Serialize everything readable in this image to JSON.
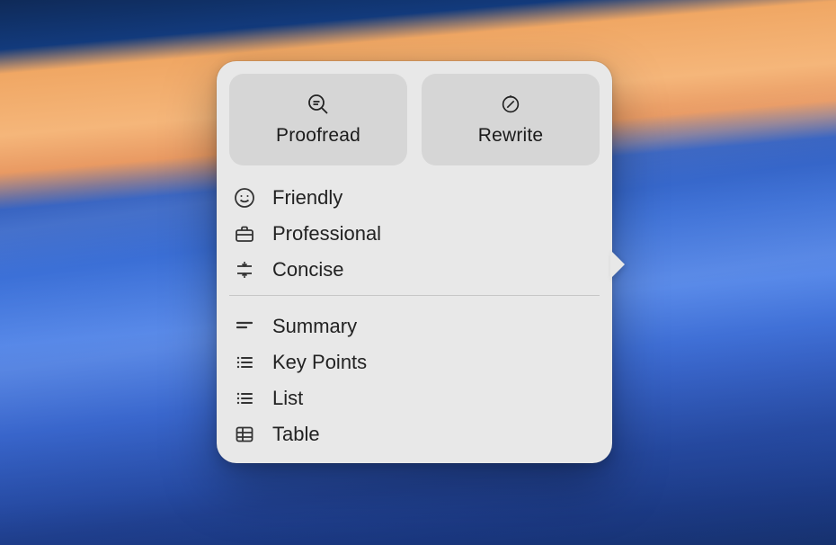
{
  "popover": {
    "buttons": {
      "proofread": "Proofread",
      "rewrite": "Rewrite"
    },
    "tones": {
      "friendly": "Friendly",
      "professional": "Professional",
      "concise": "Concise"
    },
    "formats": {
      "summary": "Summary",
      "keypoints": "Key Points",
      "list": "List",
      "table": "Table"
    }
  }
}
